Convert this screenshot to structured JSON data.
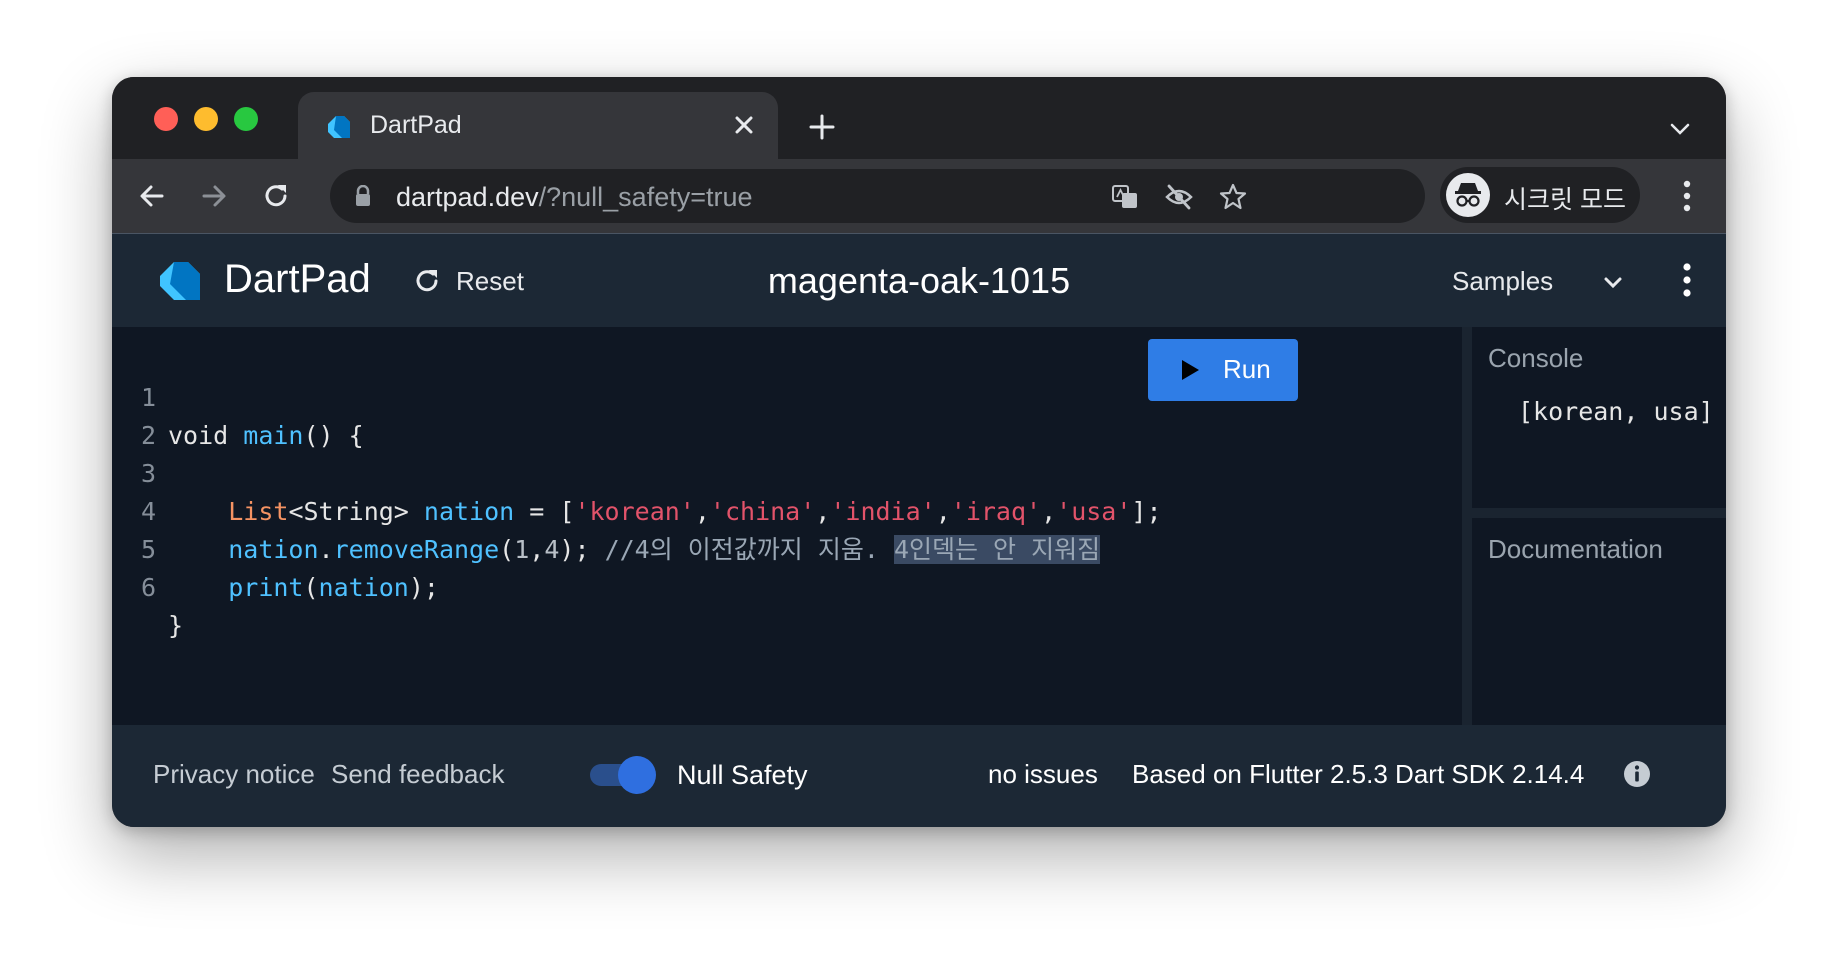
{
  "browser": {
    "tab_title": "DartPad",
    "url_host": "dartpad.dev",
    "url_path": "/?null_safety=true",
    "profile_label": "시크릿 모드",
    "icons": [
      "back-icon",
      "forward-icon",
      "reload-icon",
      "lock-icon",
      "translate-icon",
      "eye-off-icon",
      "star-icon",
      "incognito-icon",
      "menu-icon"
    ]
  },
  "header": {
    "app_name": "DartPad",
    "reset_label": "Reset",
    "pad_title": "magenta-oak-1015",
    "samples_label": "Samples"
  },
  "editor": {
    "run_label": "Run",
    "line_numbers": [
      "1",
      "2",
      "3",
      "4",
      "5",
      "6"
    ],
    "code": {
      "l1_void": "void ",
      "l1_main": "main",
      "l1_rest": "() {",
      "l3_type": "List",
      "l3_generic": "<String> ",
      "l3_var": "nation",
      "l3_eq": " = [",
      "s_korean": "'korean'",
      "s_china": "'china'",
      "s_india": "'india'",
      "s_iraq": "'iraq'",
      "s_usa": "'usa'",
      "comma": ",",
      "l3_end": "];",
      "l4_var": "nation",
      "l4_dot": ".",
      "l4_method": "removeRange",
      "l4_open": "(",
      "l4_n1": "1",
      "l4_comma": ",",
      "l4_n2": "4",
      "l4_close": "); ",
      "l4_comment": "//4의 이전값까지 지움. ",
      "l4_comment_sel": "4인덱는 안 지워짐",
      "l5_print": "print",
      "l5_open": "(",
      "l5_var": "nation",
      "l5_close": ");",
      "l6": "}"
    }
  },
  "console": {
    "heading": "Console",
    "output": "[korean, usa]"
  },
  "docs": {
    "heading": "Documentation"
  },
  "footer": {
    "privacy": "Privacy notice",
    "feedback": "Send feedback",
    "null_safety_label": "Null Safety",
    "null_safety_on": true,
    "issues": "no issues",
    "sdk_info": "Based on Flutter 2.5.3 Dart SDK 2.14.4"
  },
  "colors": {
    "accent": "#2f7de6",
    "header_bg": "#1c2835",
    "editor_bg": "#0f1723",
    "string": "#e2536a",
    "function": "#4fc1ff",
    "type": "#f59363"
  }
}
